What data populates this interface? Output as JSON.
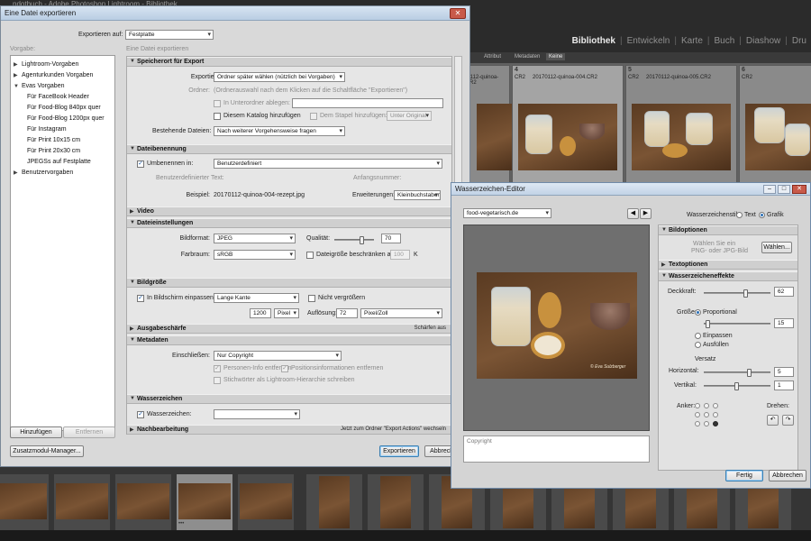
{
  "lightroom": {
    "title": "ndotbuch - Adobe Photoshop Lightroom - Bibliothek",
    "modules": [
      "Bibliothek",
      "Entwickeln",
      "Karte",
      "Buch",
      "Diashow",
      "Dru"
    ],
    "filter_tabs": [
      "Attribut",
      "Metadaten",
      "Keine"
    ],
    "grid_cells": [
      {
        "num": "",
        "name": "20170112-quinoa-003.CR2",
        "type": ""
      },
      {
        "num": "4",
        "name": "20170112-quinoa-004.CR2",
        "type": "CR2"
      },
      {
        "num": "5",
        "name": "20170112-quinoa-005.CR2",
        "type": "CR2"
      },
      {
        "num": "6",
        "name": "",
        "type": "CR2"
      }
    ],
    "filmstrip_marks": "•••"
  },
  "export_dialog": {
    "title": "Eine Datei exportieren",
    "export_to_label": "Exportieren auf:",
    "export_to_value": "Festplatte",
    "presets_label": "Vorgabe:",
    "settings_label": "Eine Datei exportieren",
    "presets": [
      {
        "label": "Lightroom-Vorgaben",
        "level": 0,
        "toggle": "▶"
      },
      {
        "label": "Agenturkunden Vorgaben",
        "level": 0,
        "toggle": "▶"
      },
      {
        "label": "Evas Vorgaben",
        "level": 0,
        "toggle": "▼"
      },
      {
        "label": "Für FaceBook Header",
        "level": 1,
        "toggle": ""
      },
      {
        "label": "Für Food-Blog 840px quer",
        "level": 1,
        "toggle": ""
      },
      {
        "label": "Für Food-Blog 1200px quer",
        "level": 1,
        "toggle": ""
      },
      {
        "label": "Für Instagram",
        "level": 1,
        "toggle": ""
      },
      {
        "label": "Für Print 10x15 cm",
        "level": 1,
        "toggle": ""
      },
      {
        "label": "Für Print 20x30 cm",
        "level": 1,
        "toggle": ""
      },
      {
        "label": "JPEGSs auf Festplatte",
        "level": 1,
        "toggle": ""
      },
      {
        "label": "Benutzervorgaben",
        "level": 0,
        "toggle": "▶"
      }
    ],
    "add_button": "Hinzufügen",
    "remove_button": "Entfernen",
    "plugin_manager_button": "Zusatzmodul-Manager...",
    "export_button": "Exportieren",
    "cancel_button": "Abbrechen",
    "sections": {
      "location": {
        "title": "Speicherort für Export",
        "export_in_label": "Exportieren in:",
        "export_in_value": "Ordner später wählen (nützlich bei Vorgaben)",
        "folder_label": "Ordner:",
        "folder_hint": "(Ordnerauswahl nach dem Klicken auf die Schaltfläche \"Exportieren\")",
        "subfolder_label": "In Unterordner ablegen:",
        "add_catalog_label": "Diesem Katalog hinzufügen",
        "add_stack_label": "Dem Stapel hinzufügen:",
        "stack_value": "Unter Original",
        "existing_label": "Bestehende Dateien:",
        "existing_value": "Nach weiterer Vorgehensweise fragen"
      },
      "naming": {
        "title": "Dateibenennung",
        "rename_label": "Umbenennen in:",
        "rename_value": "Benutzerdefiniert",
        "custom_text_label": "Benutzerdefinierter Text:",
        "start_number_label": "Anfangsnummer:",
        "example_label": "Beispiel:",
        "example_value": "20170112-quinoa-004-rezept.jpg",
        "extensions_label": "Erweiterungen:",
        "extensions_value": "Kleinbuchstaben"
      },
      "video": {
        "title": "Video"
      },
      "file_settings": {
        "title": "Dateieinstellungen",
        "format_label": "Bildformat:",
        "format_value": "JPEG",
        "quality_label": "Qualität:",
        "quality_value": "70",
        "colorspace_label": "Farbraum:",
        "colorspace_value": "sRGB",
        "limit_size_label": "Dateigröße beschränken auf:",
        "limit_value": "100",
        "limit_unit": "K"
      },
      "image_size": {
        "title": "Bildgröße",
        "fit_label": "In Bildschirm einpassen:",
        "fit_value": "Lange Kante",
        "no_enlarge_label": "Nicht vergrößern",
        "size_value": "1200",
        "size_unit": "Pixel",
        "resolution_label": "Auflösung:",
        "resolution_value": "72",
        "resolution_unit": "Pixel/Zoll"
      },
      "sharpening": {
        "title": "Ausgabeschärfe",
        "extra": "Schärfen aus"
      },
      "metadata": {
        "title": "Metadaten",
        "include_label": "Einschließen:",
        "include_value": "Nur Copyright",
        "remove_person_label": "Personen-Info entfernen",
        "remove_location_label": "Positionsinformationen entfernen",
        "keywords_label": "Stichwörter als Lightroom-Hierarchie schreiben"
      },
      "watermark": {
        "title": "Wasserzeichen",
        "watermark_label": "Wasserzeichen:"
      },
      "post": {
        "title": "Nachbearbeitung",
        "extra": "Jetzt zum Ordner \"Export Actions\" wechseln"
      }
    }
  },
  "watermark_editor": {
    "title": "Wasserzeichen-Editor",
    "preset_value": "food-vegetarisch.de",
    "style_label": "Wasserzeichenstil:",
    "style_text": "Text",
    "style_graphic": "Grafik",
    "copyright_placeholder": "Copyright",
    "image_options": {
      "title": "Bildoptionen",
      "hint_line1": "Wählen Sie ein",
      "hint_line2": "PNG- oder JPG-Bild",
      "choose_button": "Wählen..."
    },
    "text_options": {
      "title": "Textoptionen"
    },
    "effects": {
      "title": "Wasserzeicheneffekte",
      "opacity_label": "Deckkraft:",
      "opacity_value": "62",
      "size_label": "Größe:",
      "size_proportional": "Proportional",
      "size_value": "15",
      "size_fit": "Einpassen",
      "size_fill": "Ausfüllen",
      "offset_label": "Versatz",
      "horizontal_label": "Horizontal:",
      "horizontal_value": "5",
      "vertical_label": "Vertikal:",
      "vertical_value": "1",
      "anchor_label": "Anker:",
      "rotate_label": "Drehen:"
    },
    "preview_caption": "© Eva Sulzberger",
    "ok_button": "Fertig",
    "cancel_button": "Abbrechen"
  }
}
